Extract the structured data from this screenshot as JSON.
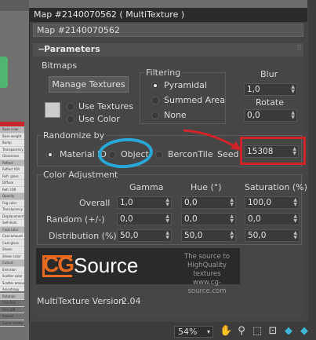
{
  "window": {
    "title": "Map #2140070562  ( MultiTexture )",
    "map_name": "Map #2140070562"
  },
  "rollout": {
    "sign": "−",
    "title": "Parameters"
  },
  "bitmaps": {
    "label": "Bitmaps",
    "manage_button": "Manage Textures",
    "use_textures": "Use Textures",
    "use_color": "Use Color",
    "swatch_color": "#cccccc"
  },
  "filtering": {
    "label": "Filtering",
    "options": [
      "Pyramidal",
      "Summed Area",
      "None"
    ],
    "selected": "Pyramidal"
  },
  "blur": {
    "label": "Blur",
    "value": "1,0"
  },
  "rotate": {
    "label": "Rotate",
    "value": "0,0"
  },
  "randomize": {
    "label": "Randomize by",
    "options": [
      "Material ID",
      "Object",
      "BerconTile"
    ],
    "selected": "Material ID",
    "seed_label": "Seed",
    "seed_value": "15308"
  },
  "color_adjustment": {
    "label": "Color Adjustment",
    "columns": [
      "Gamma",
      "Hue (°)",
      "Saturation (%)"
    ],
    "rows": [
      {
        "label": "Overall",
        "values": [
          "1,0",
          "0,0",
          "100,0"
        ]
      },
      {
        "label": "Random (+/-)",
        "values": [
          "0,0",
          "0,0",
          "0,0"
        ]
      },
      {
        "label": "Distribution (%)",
        "values": [
          "50,0",
          "50,0",
          "50,0"
        ]
      }
    ]
  },
  "banner": {
    "logo_cg": "CG",
    "logo_source": "Source",
    "tagline": [
      "The source to",
      "HighQuality textures",
      "www.cg-source.com"
    ]
  },
  "version": {
    "label": "MultiTexture Version",
    "value": "2.04"
  },
  "toolbar": {
    "zoom": "54%"
  },
  "annotation_colors": {
    "highlight_box": "#d1242a",
    "circle": "#28a8d8"
  },
  "node_panel": {
    "rows": [
      "Base color",
      "Base weight",
      "Bump",
      "Transparency",
      "Glossiness",
      "Reflect",
      "Reflect IOR",
      "Refr. gloss",
      "Diffuse",
      "Refr. IOR",
      "Opacity",
      "Fog color",
      "Translucency",
      "Displacement",
      "Self-illum",
      "Coat color",
      "Coat amount",
      "Coat gloss",
      "Sheen",
      "Sheen color",
      "Cutout",
      "Emission",
      "Scatter color",
      "Scatter amount",
      "Anisotropy",
      "Rotation",
      "Thin film",
      "Film IOR",
      "Fresnel",
      "Some scatter color"
    ]
  }
}
